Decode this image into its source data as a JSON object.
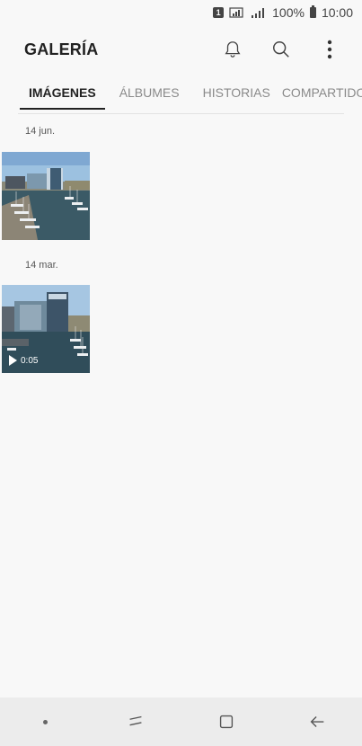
{
  "status": {
    "sim": "1",
    "battery_pct": "100%",
    "time": "10:00"
  },
  "appbar": {
    "title": "GALERÍA",
    "icons": [
      "bell-icon",
      "search-icon",
      "more-vert-icon"
    ]
  },
  "tabs": [
    {
      "label": "IMÁGENES",
      "active": true
    },
    {
      "label": "ÁLBUMES",
      "active": false
    },
    {
      "label": "HISTORIAS",
      "active": false
    },
    {
      "label": "COMPARTIDO",
      "active": false
    }
  ],
  "groups": [
    {
      "date": "14 jun.",
      "type": "image"
    },
    {
      "date": "14 mar.",
      "type": "video",
      "duration": "0:05"
    }
  ],
  "navbar": {
    "icons": [
      "dot-icon",
      "recents-icon",
      "home-icon",
      "back-icon"
    ]
  }
}
